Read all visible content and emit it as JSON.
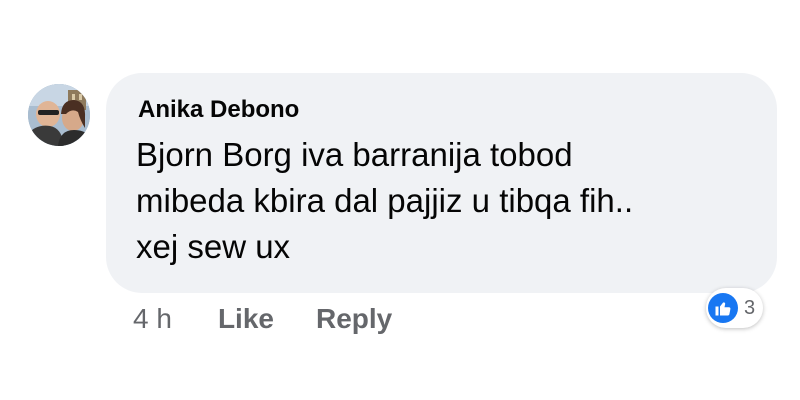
{
  "comment": {
    "author": "Anika Debono",
    "text_lines": [
      "Bjorn Borg iva barranija tobod",
      "mibeda kbira dal pajjiz u tibqa fih..",
      "xej sew ux"
    ],
    "timestamp": "4 h",
    "like_label": "Like",
    "reply_label": "Reply",
    "reaction": {
      "icon": "thumbs-up-icon",
      "count": "3",
      "color": "#1877f2"
    },
    "bubble_color": "#f0f2f5",
    "text_color": "#050505",
    "meta_color": "#65676b"
  }
}
